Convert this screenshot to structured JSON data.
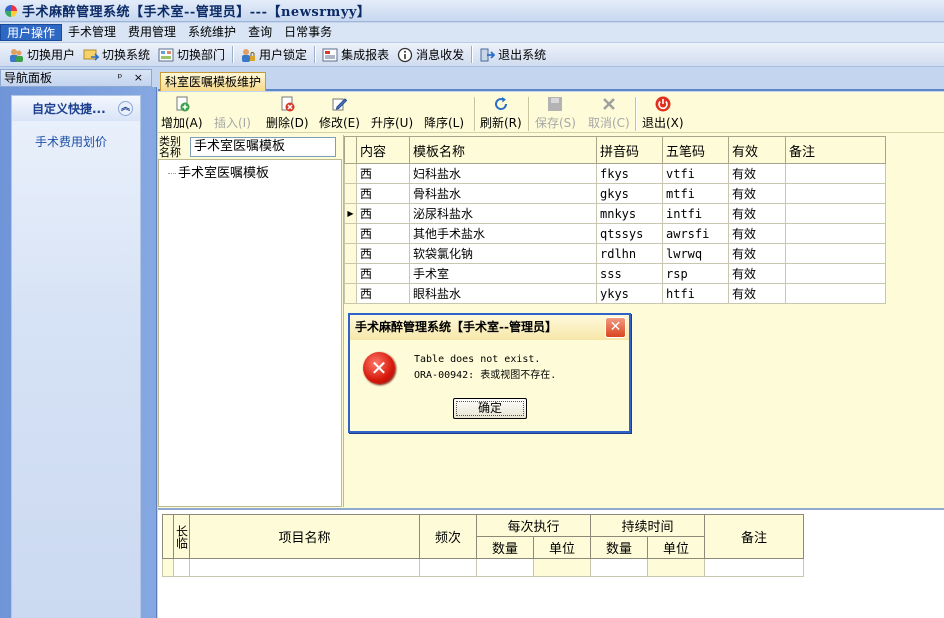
{
  "window": {
    "title": "手术麻醉管理系统【手术室--管理员】---【newsrmyy】"
  },
  "menubar": [
    {
      "label": "用户操作",
      "active": true
    },
    {
      "label": "手术管理",
      "active": false
    },
    {
      "label": "费用管理",
      "active": false
    },
    {
      "label": "系统维护",
      "active": false
    },
    {
      "label": "查询",
      "active": false
    },
    {
      "label": "日常事务",
      "active": false
    }
  ],
  "toolbar": [
    {
      "label": "切换用户",
      "icon": "users-icon"
    },
    {
      "label": "切换系统",
      "icon": "switch-system-icon"
    },
    {
      "label": "切换部门",
      "icon": "department-icon"
    },
    {
      "label": "用户锁定",
      "icon": "lock-user-icon"
    },
    {
      "label": "集成报表",
      "icon": "report-icon"
    },
    {
      "label": "消息收发",
      "icon": "info-icon"
    },
    {
      "label": "退出系统",
      "icon": "exit-icon"
    }
  ],
  "nav": {
    "header": "导航面板",
    "header_controls": "ᵖ ×",
    "group": "自定义快捷...",
    "links": [
      "手术费用划价"
    ]
  },
  "document": {
    "tab": "科室医嘱模板维护"
  },
  "content_toolbar": [
    {
      "label": "增加(A)",
      "icon": "add-icon",
      "enabled": true
    },
    {
      "label": "插入(I)",
      "icon": "insert-icon",
      "enabled": false
    },
    {
      "label": "删除(D)",
      "icon": "delete-icon",
      "enabled": true
    },
    {
      "label": "修改(E)",
      "icon": "edit-icon",
      "enabled": true
    },
    {
      "label": "升序(U)",
      "icon": "",
      "enabled": true
    },
    {
      "label": "降序(L)",
      "icon": "",
      "enabled": true
    },
    {
      "label": "刷新(R)",
      "icon": "refresh-icon",
      "enabled": true
    },
    {
      "label": "保存(S)",
      "icon": "save-icon",
      "enabled": false
    },
    {
      "label": "取消(C)",
      "icon": "cancel-icon",
      "enabled": false
    },
    {
      "label": "退出(X)",
      "icon": "power-icon",
      "enabled": true
    }
  ],
  "category": {
    "label_line1": "类别",
    "label_line2": "名称",
    "value": "手术室医嘱模板",
    "tree_node": "手术室医嘱模板"
  },
  "grid": {
    "columns": [
      "内容",
      "模板名称",
      "拼音码",
      "五笔码",
      "有效",
      "备注"
    ],
    "current_row_marker": "▶",
    "rows": [
      {
        "content": "西",
        "name": "妇科盐水",
        "pinyin": "fkys",
        "wubi": "vtfi",
        "valid": "有效",
        "note": "",
        "current": false
      },
      {
        "content": "西",
        "name": "骨科盐水",
        "pinyin": "gkys",
        "wubi": "mtfi",
        "valid": "有效",
        "note": "",
        "current": false
      },
      {
        "content": "西",
        "name": "泌尿科盐水",
        "pinyin": "mnkys",
        "wubi": "intfi",
        "valid": "有效",
        "note": "",
        "current": true
      },
      {
        "content": "西",
        "name": "其他手术盐水",
        "pinyin": "qtssys",
        "wubi": "awrsfi",
        "valid": "有效",
        "note": "",
        "current": false
      },
      {
        "content": "西",
        "name": "软袋氯化钠",
        "pinyin": "rdlhn",
        "wubi": "lwrwq",
        "valid": "有效",
        "note": "",
        "current": false
      },
      {
        "content": "西",
        "name": "手术室",
        "pinyin": "sss",
        "wubi": "rsp",
        "valid": "有效",
        "note": "",
        "current": false
      },
      {
        "content": "西",
        "name": "眼科盐水",
        "pinyin": "ykys",
        "wubi": "htfi",
        "valid": "有效",
        "note": "",
        "current": false
      }
    ]
  },
  "bottom_grid": {
    "col_long_temp": "长临",
    "col_item": "项目名称",
    "col_freq": "频次",
    "group_each": "每次执行",
    "group_duration": "持续时间",
    "col_note": "备注",
    "sub_qty": "数量",
    "sub_unit": "单位"
  },
  "dialog": {
    "title": "手术麻醉管理系统【手术室--管理员】",
    "message_line1": "Table does not exist.",
    "message_line2": "ORA-00942: 表或视图不存在.",
    "ok_label": "确定",
    "close_glyph": "✕",
    "icon_glyph": "✕"
  }
}
